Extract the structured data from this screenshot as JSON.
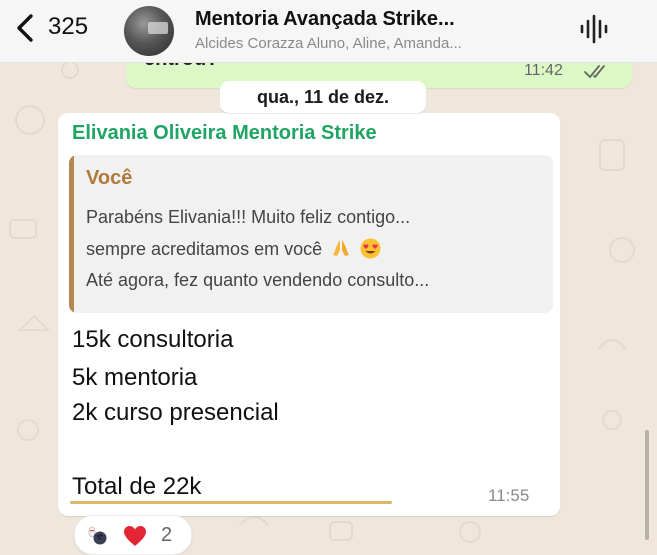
{
  "header": {
    "back_count": "325",
    "title": "Mentoria Avançada Strike...",
    "subtitle": "Alcides Corazza Aluno, Aline, Amanda..."
  },
  "previous_message": {
    "text": "entrou?",
    "time": "11:42",
    "status": "read"
  },
  "date_separator": "qua., 11 de dez.",
  "message": {
    "sender": "Elivania Oliveira Mentoria Strike",
    "quote": {
      "author": "Você",
      "lines": [
        "Parabéns Elivania!!! Muito feliz contigo...",
        "sempre acreditamos em você",
        "Até agora, fez quanto vendendo consulto..."
      ]
    },
    "lines": [
      "15k consultoria",
      "5k mentoria",
      "2k curso presencial",
      "Total de 22k"
    ],
    "time": "11:55"
  },
  "reactions": {
    "count": "2",
    "emojis": [
      "bowling-emoji",
      "heart-emoji"
    ]
  },
  "colors": {
    "sender_green": "#1fa463",
    "quote_gold": "#b4884d",
    "outgoing_bubble": "#dcf8c6"
  }
}
